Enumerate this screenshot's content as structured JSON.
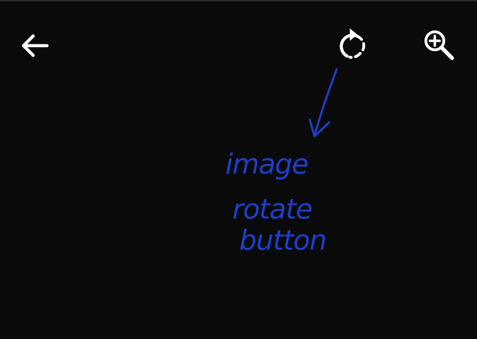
{
  "toolbar": {
    "back_icon": "arrow-left-icon",
    "rotate_icon": "rotate-icon",
    "zoom_icon": "zoom-in-icon"
  },
  "annotation": {
    "lines": [
      "image",
      "rotate",
      "button"
    ],
    "color": "#1e3fcc"
  },
  "colors": {
    "background": "#0a0a0a",
    "icon": "#ffffff"
  }
}
